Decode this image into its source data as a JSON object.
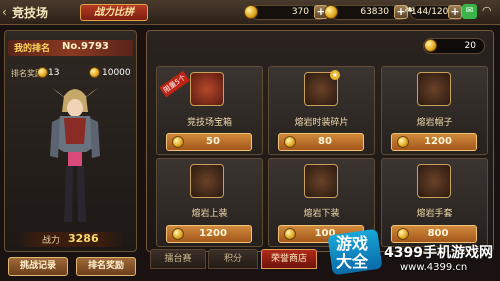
{
  "header": {
    "title": "竞技场",
    "tag": "战力比拼",
    "gold": "370",
    "coins": "63830",
    "stamina": "144/120"
  },
  "left": {
    "rank_label": "我的排名",
    "rank_no": "No.9793",
    "reward_label": "排名奖励",
    "reward_medals": "13",
    "reward_coins": "10000",
    "power_label": "战力",
    "power_value": "3286",
    "btn_record": "挑战记录",
    "btn_reward": "排名奖励"
  },
  "shop": {
    "honor_points": "20",
    "items": [
      {
        "name": "竞技场宝箱",
        "price": "50",
        "badge": "限量5个",
        "icon": "treasure-chest"
      },
      {
        "name": "熔岩时装碎片",
        "price": "80",
        "icon": "lava-costume-shard"
      },
      {
        "name": "熔岩帽子",
        "price": "1200",
        "icon": "lava-hat"
      },
      {
        "name": "熔岩上装",
        "price": "1200",
        "icon": "lava-top"
      },
      {
        "name": "熔岩下装",
        "price": "100",
        "icon": "lava-pants"
      },
      {
        "name": "熔岩手套",
        "price": "800",
        "icon": "lava-gloves"
      }
    ]
  },
  "tabs": [
    "擂台赛",
    "积分",
    "荣誉商店"
  ],
  "watermark": {
    "logo_line1": "游戏",
    "logo_line2": "大全",
    "site": "4399手机游戏网",
    "url": "www.4399.cn"
  },
  "colors": {
    "accent": "#b02a1a",
    "gold": "#e3a51c",
    "price_button": "#d18a3c"
  }
}
